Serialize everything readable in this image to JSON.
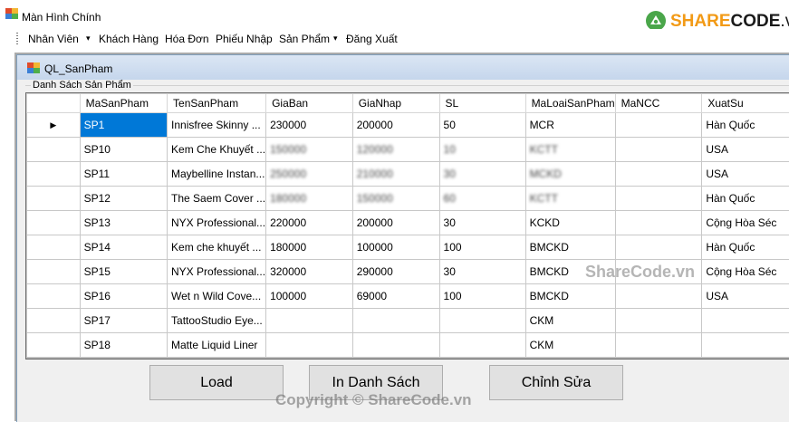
{
  "window": {
    "title": "Màn Hình Chính"
  },
  "brand": {
    "part_a": "SHARE",
    "part_b": "CODE",
    "part_c": ".vn"
  },
  "menu": {
    "items": [
      "Nhân Viên",
      "Khách Hàng",
      "Hóa Đơn",
      "Phiếu Nhập",
      "Sản Phẩm",
      "Đăng Xuất"
    ],
    "dropdown_arrow": "▾"
  },
  "child": {
    "title": "QL_SanPham",
    "group_label": "Danh Sách Sản Phẩm"
  },
  "grid": {
    "columns": [
      "MaSanPham",
      "TenSanPham",
      "GiaBan",
      "GiaNhap",
      "SL",
      "MaLoaiSanPham",
      "MaNCC",
      "XuatSu"
    ],
    "current_row_marker": "▶",
    "rows": [
      [
        "SP1",
        "Innisfree Skinny ...",
        "230000",
        "200000",
        "50",
        "MCR",
        "",
        "Hàn Quốc"
      ],
      [
        "SP10",
        "Kem Che Khuyết ...",
        "150000",
        "120000",
        "10",
        "KCTT",
        "",
        "USA"
      ],
      [
        "SP11",
        "Maybelline Instan...",
        "250000",
        "210000",
        "30",
        "MCKD",
        "",
        "USA"
      ],
      [
        "SP12",
        "The Saem Cover ...",
        "180000",
        "150000",
        "60",
        "KCTT",
        "",
        "Hàn Quốc"
      ],
      [
        "SP13",
        "NYX Professional...",
        "220000",
        "200000",
        "30",
        "KCKD",
        "",
        "Cộng Hòa Séc"
      ],
      [
        "SP14",
        "Kem che khuyết ...",
        "180000",
        "100000",
        "100",
        "BMCKD",
        "",
        "Hàn Quốc"
      ],
      [
        "SP15",
        "NYX Professional...",
        "320000",
        "290000",
        "30",
        "BMCKD",
        "",
        "Cộng Hòa Séc"
      ],
      [
        "SP16",
        "Wet n Wild Cove...",
        "100000",
        "69000",
        "100",
        "BMCKD",
        "",
        "USA"
      ],
      [
        "SP17",
        "TattooStudio Eye...",
        "",
        "",
        "",
        "CKM",
        "",
        ""
      ],
      [
        "SP18",
        "Matte Liquid Liner",
        "",
        "",
        "",
        "CKM",
        "",
        ""
      ]
    ],
    "selected_cell": {
      "row": 0,
      "column": 0
    },
    "obscured_rows": [
      1,
      2,
      3
    ]
  },
  "buttons": {
    "load": "Load",
    "print": "In Danh Sách",
    "edit": "Chỉnh Sửa"
  },
  "watermark": "ShareCode.vn",
  "copyright": "Copyright © ShareCode.vn",
  "colors": {
    "selection": "#0078d7",
    "brand_orange": "#f29a16",
    "child_title": "#c5d6ec"
  }
}
